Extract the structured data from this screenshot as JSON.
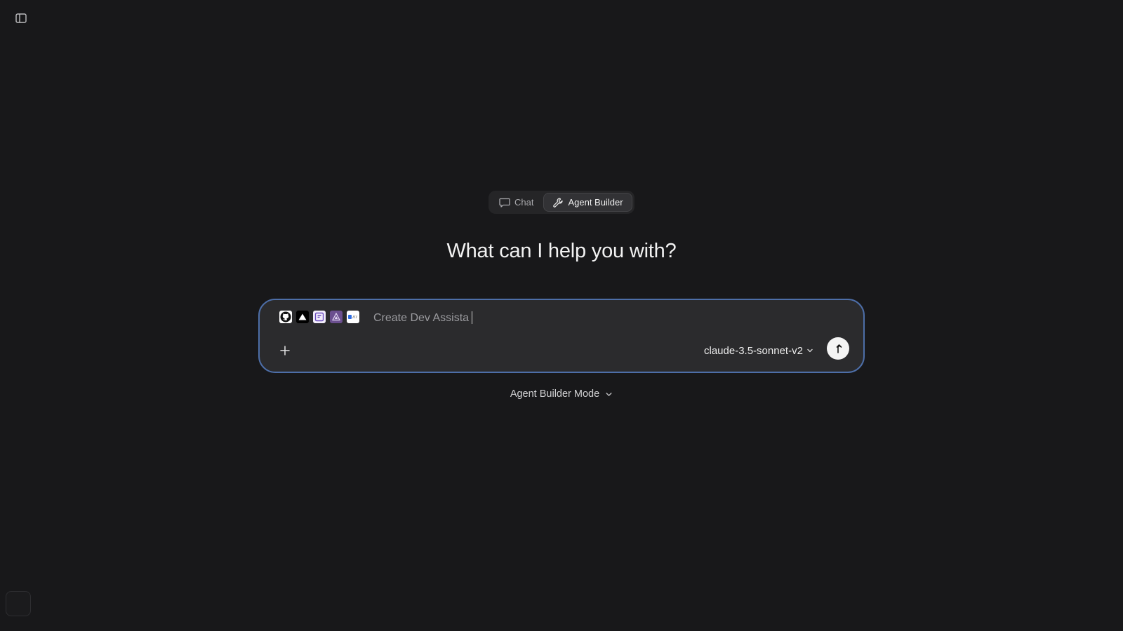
{
  "mode_switch": {
    "chat_label": "Chat",
    "agent_builder_label": "Agent Builder",
    "active": "Agent Builder"
  },
  "headline": "What can I help you with?",
  "composer": {
    "integrations": [
      "github-icon",
      "vercel-icon",
      "jira-icon",
      "linear-icon",
      "notion-icon"
    ],
    "input_value": "Create Dev Assista",
    "model": "claude-3.5-sonnet-v2"
  },
  "mode_dropdown": {
    "label": "Agent Builder Mode"
  },
  "colors": {
    "background": "#18181a",
    "composer_border": "#4d6ea8",
    "composer_bg": "#2b2b2d"
  }
}
